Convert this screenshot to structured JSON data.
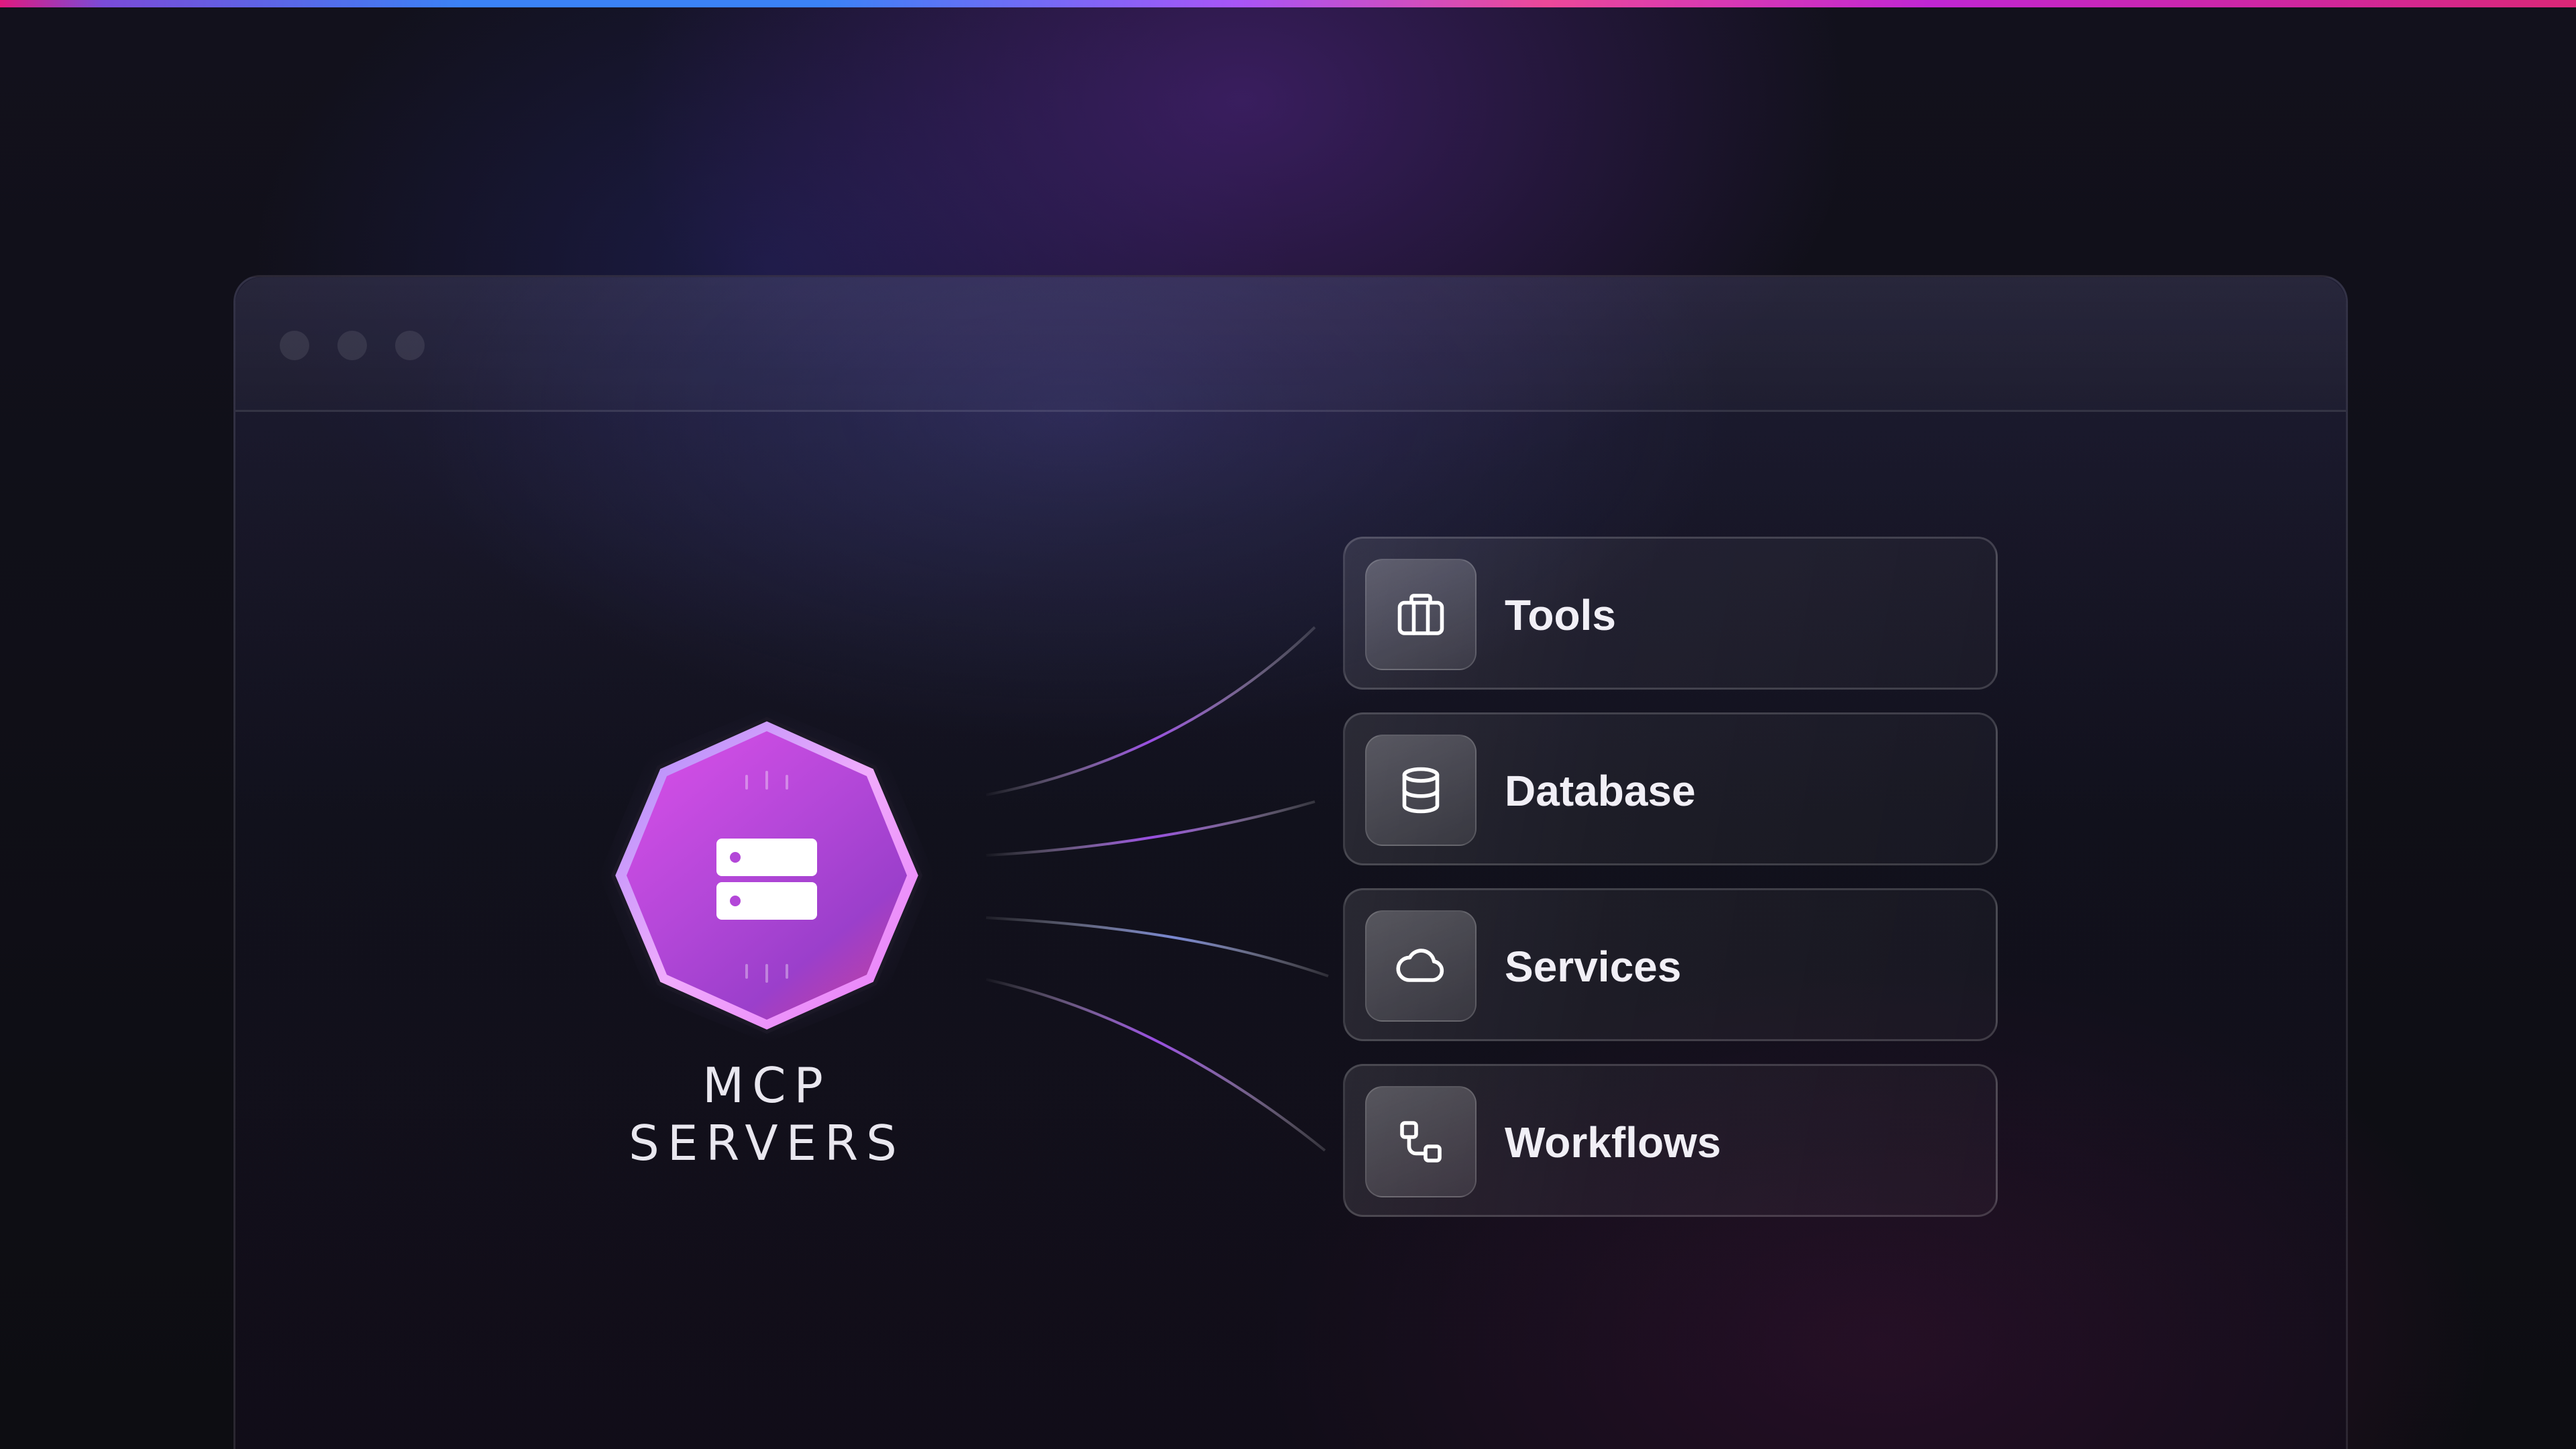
{
  "hero": {
    "title_line1": "MCP",
    "title_line2": "SERVERS",
    "badge_icon": "server-icon"
  },
  "window": {
    "controls": [
      "close-dot",
      "minimize-dot",
      "maximize-dot"
    ]
  },
  "capabilities": [
    {
      "label": "Tools",
      "icon": "briefcase-icon"
    },
    {
      "label": "Database",
      "icon": "database-icon"
    },
    {
      "label": "Services",
      "icon": "cloud-icon"
    },
    {
      "label": "Workflows",
      "icon": "workflow-icon"
    }
  ],
  "colors": {
    "accent_pink": "#d946ef",
    "accent_purple": "#8b5cf6",
    "accent_blue": "#3b82f6",
    "background": "#0c0c10"
  }
}
